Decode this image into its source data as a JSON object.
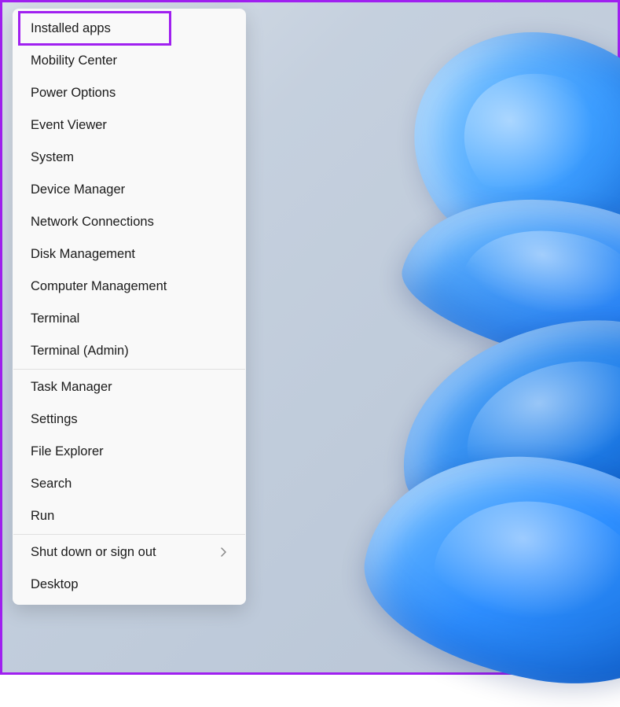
{
  "menu": {
    "groups": [
      {
        "items": [
          {
            "label": "Installed apps",
            "has_submenu": false,
            "highlighted": true
          },
          {
            "label": "Mobility Center",
            "has_submenu": false
          },
          {
            "label": "Power Options",
            "has_submenu": false
          },
          {
            "label": "Event Viewer",
            "has_submenu": false
          },
          {
            "label": "System",
            "has_submenu": false
          },
          {
            "label": "Device Manager",
            "has_submenu": false
          },
          {
            "label": "Network Connections",
            "has_submenu": false
          },
          {
            "label": "Disk Management",
            "has_submenu": false
          },
          {
            "label": "Computer Management",
            "has_submenu": false
          },
          {
            "label": "Terminal",
            "has_submenu": false
          },
          {
            "label": "Terminal (Admin)",
            "has_submenu": false
          }
        ]
      },
      {
        "items": [
          {
            "label": "Task Manager",
            "has_submenu": false
          },
          {
            "label": "Settings",
            "has_submenu": false
          },
          {
            "label": "File Explorer",
            "has_submenu": false
          },
          {
            "label": "Search",
            "has_submenu": false
          },
          {
            "label": "Run",
            "has_submenu": false
          }
        ]
      },
      {
        "items": [
          {
            "label": "Shut down or sign out",
            "has_submenu": true
          },
          {
            "label": "Desktop",
            "has_submenu": false
          }
        ]
      }
    ]
  },
  "colors": {
    "highlight_border": "#a020f0",
    "menu_bg": "#f9f9f9",
    "menu_text": "#1a1a1a"
  }
}
